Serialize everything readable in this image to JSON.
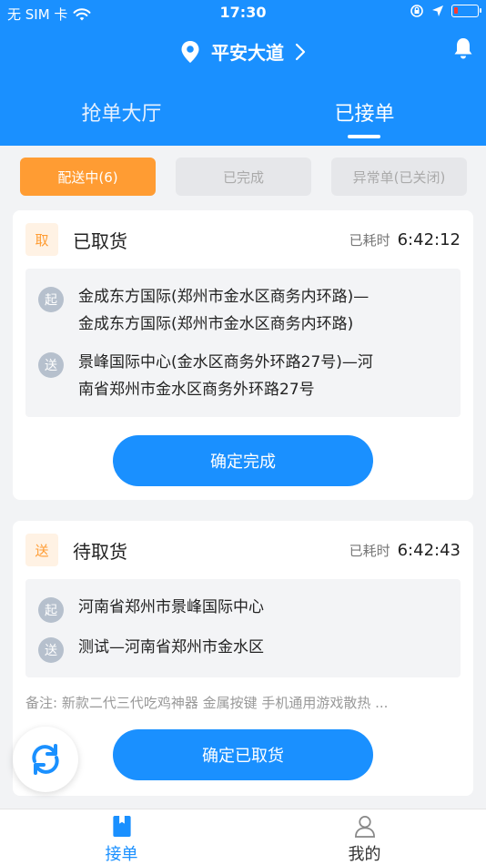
{
  "status_bar": {
    "carrier": "无 SIM 卡",
    "time": "17:30"
  },
  "header": {
    "location": "平安大道"
  },
  "tabs": [
    {
      "label": "抢单大厅",
      "active": false
    },
    {
      "label": "已接单",
      "active": true
    }
  ],
  "filters": [
    {
      "label": "配送中(6)",
      "active": true
    },
    {
      "label": "已完成",
      "active": false
    },
    {
      "label": "异常单(已关闭)",
      "active": false
    }
  ],
  "orders": [
    {
      "tag": "取",
      "status": "已取货",
      "elapsed_label": "已耗时",
      "elapsed": "6:42:12",
      "from_icon": "起",
      "from_line1": "金成东方国际(郑州市金水区商务内环路)—",
      "from_line2": "金成东方国际(郑州市金水区商务内环路)",
      "to_icon": "送",
      "to_line1": "景峰国际中心(金水区商务外环路27号)—河",
      "to_line2": "南省郑州市金水区商务外环路27号",
      "button": "确定完成"
    },
    {
      "tag": "送",
      "status": "待取货",
      "elapsed_label": "已耗时",
      "elapsed": "6:42:43",
      "from_icon": "起",
      "from_line1": "河南省郑州市景峰国际中心",
      "to_icon": "送",
      "to_line1": "测试—河南省郑州市金水区",
      "remark": "备注: 新款二代三代吃鸡神器 金属按键 手机通用游戏散热 ...",
      "button": "确定已取货"
    }
  ],
  "bottom_nav": [
    {
      "label": "接单",
      "active": true
    },
    {
      "label": "我的",
      "active": false
    }
  ],
  "colors": {
    "primary": "#1a90ff",
    "accent": "#ff9c33",
    "battery_low": "#ff3b30"
  }
}
